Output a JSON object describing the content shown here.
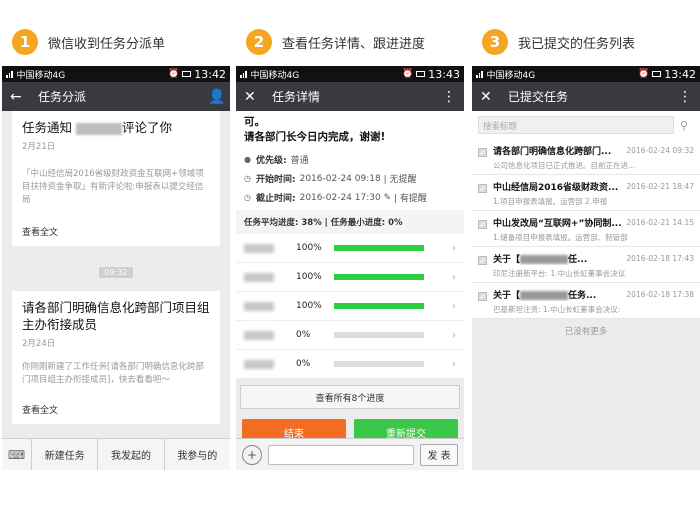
{
  "steps": [
    {
      "num": "1",
      "caption": "微信收到任务分派单"
    },
    {
      "num": "2",
      "caption": "查看任务详情、跟进进度"
    },
    {
      "num": "3",
      "caption": "我已提交的任务列表"
    }
  ],
  "colors": {
    "accent": "#f5a623",
    "titlebar": "#393a3f",
    "orange_btn": "#f36c21",
    "green_btn": "#3bc74a",
    "progress": "#2ecc40"
  },
  "phone1": {
    "status": {
      "carrier": "中国移动4G",
      "time": "13:42"
    },
    "title": "任务分派",
    "card1": {
      "title_prefix": "任务通知",
      "title_suffix": "评论了你",
      "date": "2月21日",
      "body": "「中山经信局2016省级财政资金互联网+领域项目扶持资金争取」有新评论啦:申报表以提交经信局",
      "more": "查看全文"
    },
    "time_sep": "09:32",
    "card2": {
      "title": "请各部门明确信息化跨部门项目组主办衔接成员",
      "date": "2月24日",
      "body": "你刚刚新建了工作任务[请各部门明确信息化跨部门项目组主办衔接成员]，快去看看吧～",
      "more": "查看全文"
    },
    "menu": [
      "新建任务",
      "我发起的",
      "我参与的"
    ]
  },
  "phone2": {
    "status": {
      "carrier": "中国移动4G",
      "time": "13:43"
    },
    "title": "任务详情",
    "text_line1": "可。",
    "text_line2": "请各部门长今日内完成，谢谢!",
    "priority_label": "优先级:",
    "priority_value": "普通",
    "start_label": "开始时间:",
    "start_value": "2016-02-24 09:18",
    "start_remind": "| 无提醒",
    "end_label": "截止时间:",
    "end_value": "2016-02-24 17:30",
    "end_remind": "| 有提醒",
    "avg_progress": "任务平均进度: 38% | 任务最小进度: 0%",
    "rows": [
      {
        "pct": "100%",
        "progress": 100
      },
      {
        "pct": "100%",
        "progress": 100
      },
      {
        "pct": "100%",
        "progress": 100
      },
      {
        "pct": "0%",
        "progress": 0
      },
      {
        "pct": "0%",
        "progress": 0
      }
    ],
    "view_all": "查看所有8个进度",
    "end_btn": "结束",
    "resubmit_btn": "重新提交",
    "send_btn": "发 表"
  },
  "phone3": {
    "status": {
      "carrier": "中国移动4G",
      "time": "13:42"
    },
    "title": "已提交任务",
    "search_placeholder": "搜索标题",
    "items": [
      {
        "title": "请各部门明确信息化跨部门...",
        "date": "2016-02-24 09:32",
        "sub": "公司信息化项目已正式推进。目前正在进..."
      },
      {
        "title": "中山经信局2016省级财政资...",
        "date": "2016-02-21 18:47",
        "sub": "1.项目申报表填报。运营部 2.申报"
      },
      {
        "title": "中山发改局“互联网+”协同制...",
        "date": "2016-02-21 14:15",
        "sub": "1.储备项目申报表填报。运营部、制管部"
      },
      {
        "title_prefix": "关于【",
        "title_suffix": "任...",
        "date": "2016-02-18 17:43",
        "sub": "印尼注册新平台: 1.中山长虹董事会决议"
      },
      {
        "title_prefix": "关于【",
        "title_suffix": "任务...",
        "date": "2016-02-18 17:38",
        "sub": "巴基斯坦注资: 1.中山长虹董事会决议:"
      }
    ],
    "no_more": "已没有更多"
  }
}
